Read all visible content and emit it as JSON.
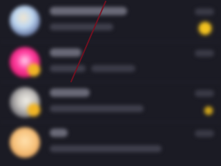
{
  "chat_list": {
    "items": [
      {
        "name": "",
        "preview": "",
        "time": "",
        "avatar_color": "#bfd8f2",
        "indicator": "unread",
        "indicator_color": "#f2c21f"
      },
      {
        "name": "",
        "preview": "",
        "time": "",
        "avatar_color": "#ff3fa0",
        "indicator": "none"
      },
      {
        "name": "",
        "preview": "",
        "time": "",
        "avatar_color": "#c9c6c2",
        "indicator": "unread-small",
        "indicator_color": "#cba21b"
      },
      {
        "name": "",
        "preview": "",
        "time": "",
        "avatar_color": "#f7c37e",
        "indicator": "none"
      }
    ]
  },
  "overlay": {
    "streak_color": "#7a0f20"
  },
  "theme": {
    "background": "#1b1b24",
    "badge_color": "#f1b526"
  }
}
